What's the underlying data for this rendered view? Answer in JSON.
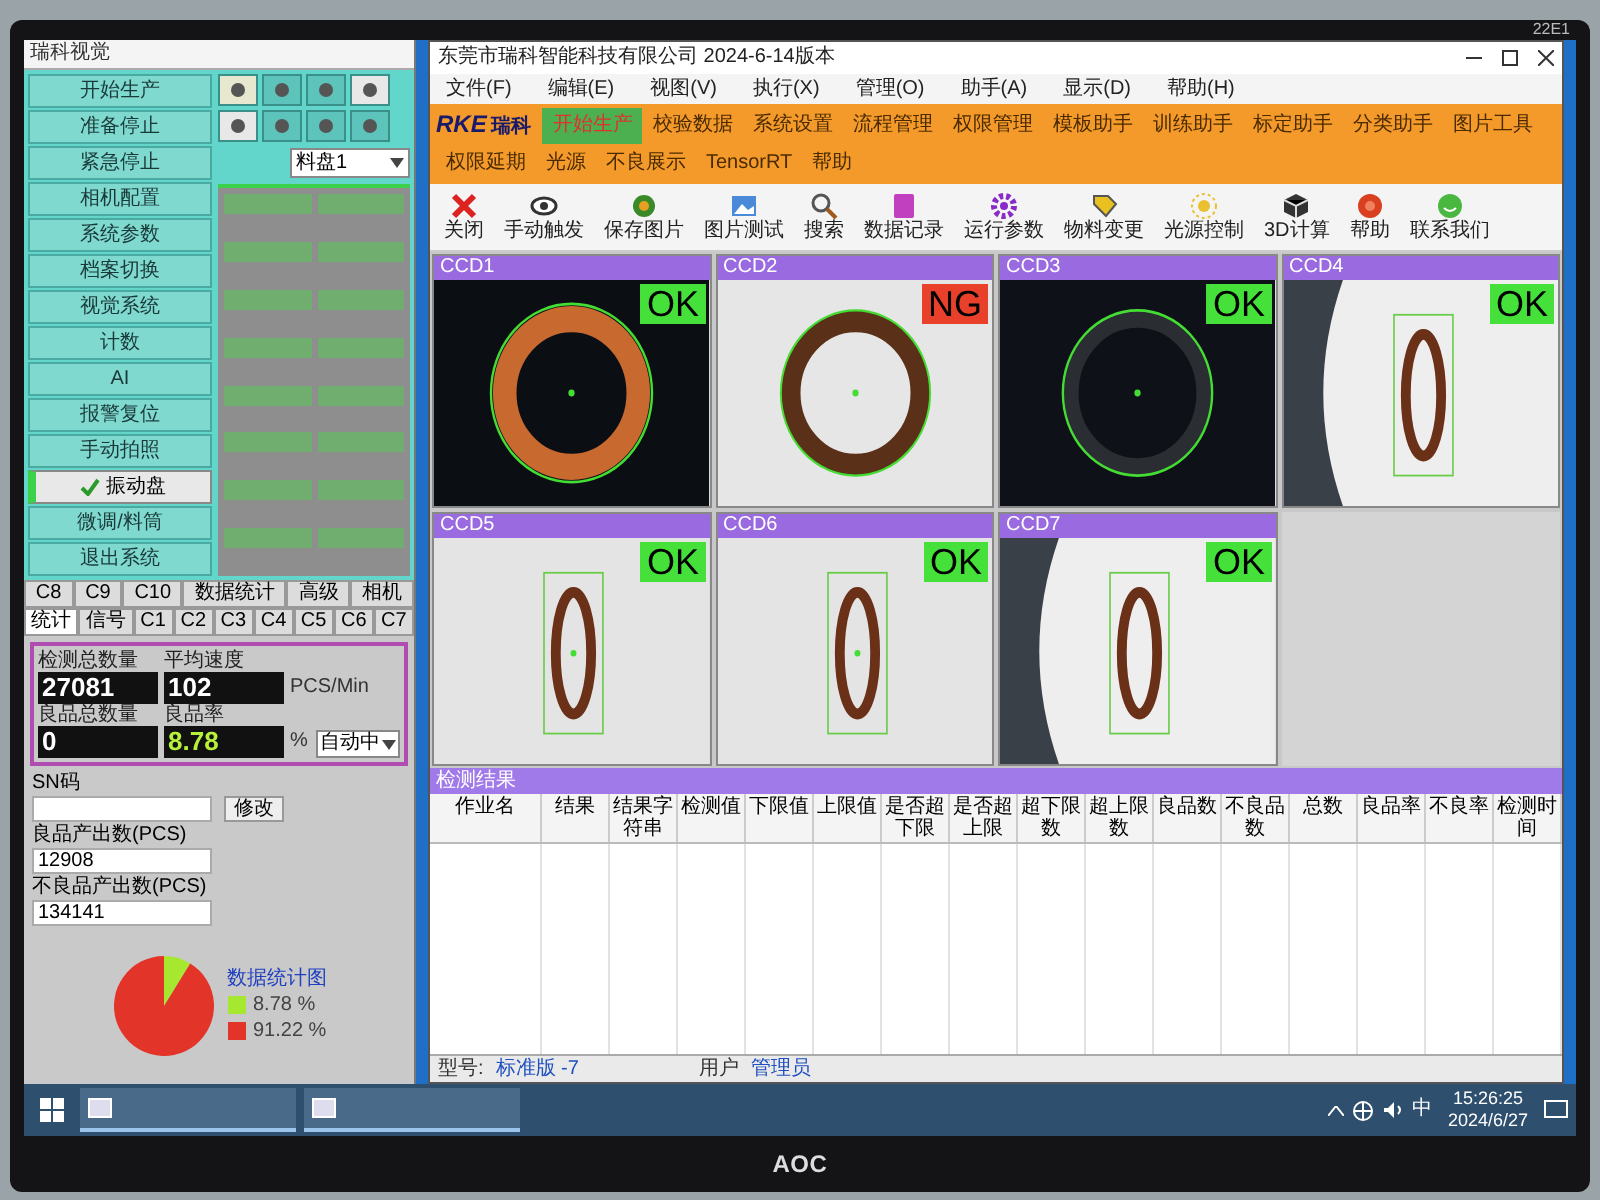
{
  "monitor": {
    "model": "22E1",
    "brand": "AOC"
  },
  "control_panel": {
    "title": "瑞科视觉",
    "buttons": [
      {
        "label": "开始生产",
        "checked": false
      },
      {
        "label": "准备停止",
        "checked": false
      },
      {
        "label": "紧急停止",
        "checked": false
      },
      {
        "label": "相机配置",
        "checked": false
      },
      {
        "label": "系统参数",
        "checked": false
      },
      {
        "label": "档案切换",
        "checked": false
      },
      {
        "label": "视觉系统",
        "checked": false
      },
      {
        "label": "计数",
        "checked": false
      },
      {
        "label": "AI",
        "checked": false
      },
      {
        "label": "报警复位",
        "checked": false
      },
      {
        "label": "手动拍照",
        "checked": false
      },
      {
        "label": "振动盘",
        "checked": true
      },
      {
        "label": "微调/料筒",
        "checked": false
      },
      {
        "label": "退出系统",
        "checked": false
      }
    ],
    "tray_select": {
      "value": "料盘1"
    },
    "tabs_row_1": [
      {
        "label": "C8",
        "selected": false
      },
      {
        "label": "C9",
        "selected": false
      },
      {
        "label": "C10",
        "selected": false
      },
      {
        "label": "数据统计",
        "selected": false
      },
      {
        "label": "高级",
        "selected": false
      },
      {
        "label": "相机",
        "selected": false
      }
    ],
    "tabs_row_2": [
      {
        "label": "统计",
        "selected": true
      },
      {
        "label": "信号",
        "selected": false
      },
      {
        "label": "C1",
        "selected": false
      },
      {
        "label": "C2",
        "selected": false
      },
      {
        "label": "C3",
        "selected": false
      },
      {
        "label": "C4",
        "selected": false
      },
      {
        "label": "C5",
        "selected": false
      },
      {
        "label": "C6",
        "selected": false
      },
      {
        "label": "C7",
        "selected": false
      }
    ],
    "stats": [
      {
        "label": "检测总数量",
        "value": "27081",
        "highlighted": false
      },
      {
        "label": "平均速度",
        "value": "102",
        "unit": "PCS/Min",
        "highlighted": false
      },
      {
        "label": "良品总数量",
        "value": "0",
        "highlighted": false
      },
      {
        "label": "良品率",
        "value": "8.78",
        "unit": "%",
        "highlighted": true
      }
    ],
    "mode_select": {
      "value": "自动中"
    },
    "sn": {
      "label": "SN码",
      "button": "修改"
    },
    "outputs": [
      {
        "label": "良品产出数(PCS)",
        "value": "12908"
      },
      {
        "label": "不良品产出数(PCS)",
        "value": "134141"
      }
    ],
    "pie": {
      "slices": [
        {
          "color": "#a6e830"
        },
        {
          "color": "#e3342a"
        }
      ],
      "chart_data": {
        "type": "pie",
        "title": "数据统计图",
        "categories": [
          "8.78 %",
          "91.22 %"
        ],
        "values": [
          8.78,
          91.22
        ],
        "legend": "right"
      }
    }
  },
  "main_window": {
    "title": "东莞市瑞科智能科技有限公司 2024-6-14版本",
    "menu": [
      "文件(F)",
      "编辑(E)",
      "视图(V)",
      "执行(X)",
      "管理(O)",
      "助手(A)",
      "显示(D)",
      "帮助(H)"
    ],
    "brand": {
      "logo": "RKE",
      "name": "瑞科"
    },
    "nav": [
      {
        "label": "开始生产",
        "selected": true
      },
      {
        "label": "校验数据",
        "selected": false
      },
      {
        "label": "系统设置",
        "selected": false
      },
      {
        "label": "流程管理",
        "selected": false
      },
      {
        "label": "权限管理",
        "selected": false
      },
      {
        "label": "模板助手",
        "selected": false
      },
      {
        "label": "训练助手",
        "selected": false
      },
      {
        "label": "标定助手",
        "selected": false
      },
      {
        "label": "分类助手",
        "selected": false
      },
      {
        "label": "图片工具",
        "selected": false
      },
      {
        "label": "权限延期",
        "selected": false
      },
      {
        "label": "光源",
        "selected": false
      },
      {
        "label": "不良展示",
        "selected": false
      },
      {
        "label": "TensorRT",
        "selected": false
      },
      {
        "label": "帮助",
        "selected": false
      }
    ],
    "toolbar": [
      {
        "label": "关闭",
        "kind": "close"
      },
      {
        "label": "手动触发",
        "kind": "eye"
      },
      {
        "label": "保存图片",
        "kind": "save"
      },
      {
        "label": "图片测试",
        "kind": "image"
      },
      {
        "label": "搜索",
        "kind": "search"
      },
      {
        "label": "数据记录",
        "kind": "book"
      },
      {
        "label": "运行参数",
        "kind": "gear"
      },
      {
        "label": "物料变更",
        "kind": "tag"
      },
      {
        "label": "光源控制",
        "kind": "sun"
      },
      {
        "label": "3D计算",
        "kind": "cube"
      },
      {
        "label": "帮助",
        "kind": "help"
      },
      {
        "label": "联系我们",
        "kind": "smile"
      }
    ],
    "cameras": [
      {
        "name": "CCD1",
        "result": "OK",
        "color": "#45e03a",
        "kind": "dark_orange"
      },
      {
        "name": "CCD2",
        "result": "NG",
        "color": "#e8402a",
        "kind": "light_brown"
      },
      {
        "name": "CCD3",
        "result": "OK",
        "color": "#45e03a",
        "kind": "dark_black"
      },
      {
        "name": "CCD4",
        "result": "OK",
        "color": "#45e03a",
        "kind": "side_shadow"
      },
      {
        "name": "CCD5",
        "result": "OK",
        "color": "#45e03a",
        "kind": "side_plain"
      },
      {
        "name": "CCD6",
        "result": "OK",
        "color": "#45e03a",
        "kind": "side_plain"
      },
      {
        "name": "CCD7",
        "result": "OK",
        "color": "#45e03a",
        "kind": "side_shadow"
      }
    ],
    "table": {
      "title": "检测结果",
      "columns": [
        "作业名",
        "结果",
        "结果字符串",
        "检测值",
        "下限值",
        "上限值",
        "是否超下限",
        "是否超上限",
        "超下限数",
        "超上限数",
        "良品数",
        "不良品数",
        "总数",
        "良品率",
        "不良率",
        "检测时间"
      ]
    },
    "status_bar": [
      {
        "label": "型号:",
        "value": "标准版 -7"
      },
      {
        "label": "用户",
        "value": "管理员"
      }
    ]
  },
  "taskbar": {
    "ime": "中",
    "time": "15:26:25",
    "date": "2024/6/27"
  }
}
